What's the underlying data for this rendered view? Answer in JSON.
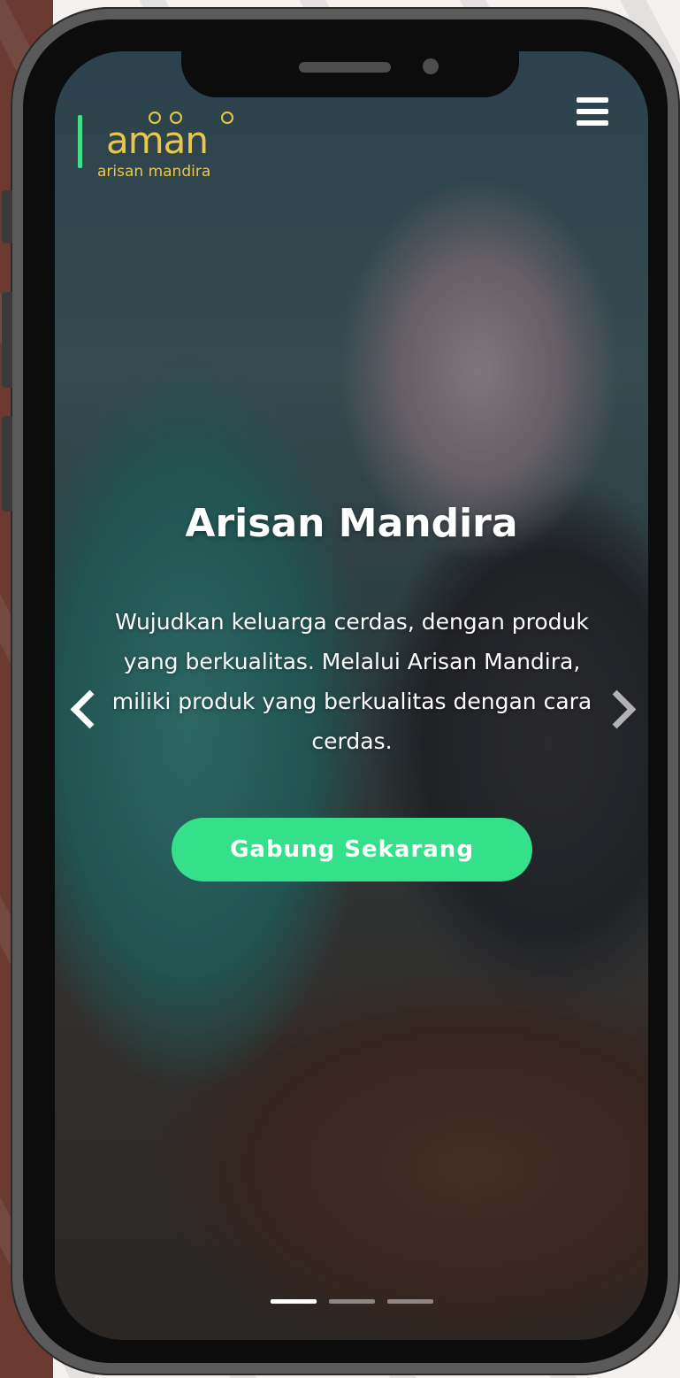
{
  "logo": {
    "word": "aman",
    "subtitle": "arisan mandira",
    "accent_color": "#3ee08a",
    "text_color": "#e8c84a"
  },
  "navbar": {
    "menu_icon": "hamburger-menu-icon"
  },
  "hero": {
    "title": "Arisan Mandira",
    "description": "Wujudkan keluarga cerdas, dengan produk yang berkualitas. Melalui Arisan Mandira, miliki produk yang berkualitas dengan cara cerdas.",
    "cta_label": "Gabung Sekarang",
    "cta_color": "#35e08a"
  },
  "carousel": {
    "prev_icon": "chevron-left-icon",
    "next_icon": "chevron-right-icon",
    "slide_count": 3,
    "active_slide": 1
  }
}
